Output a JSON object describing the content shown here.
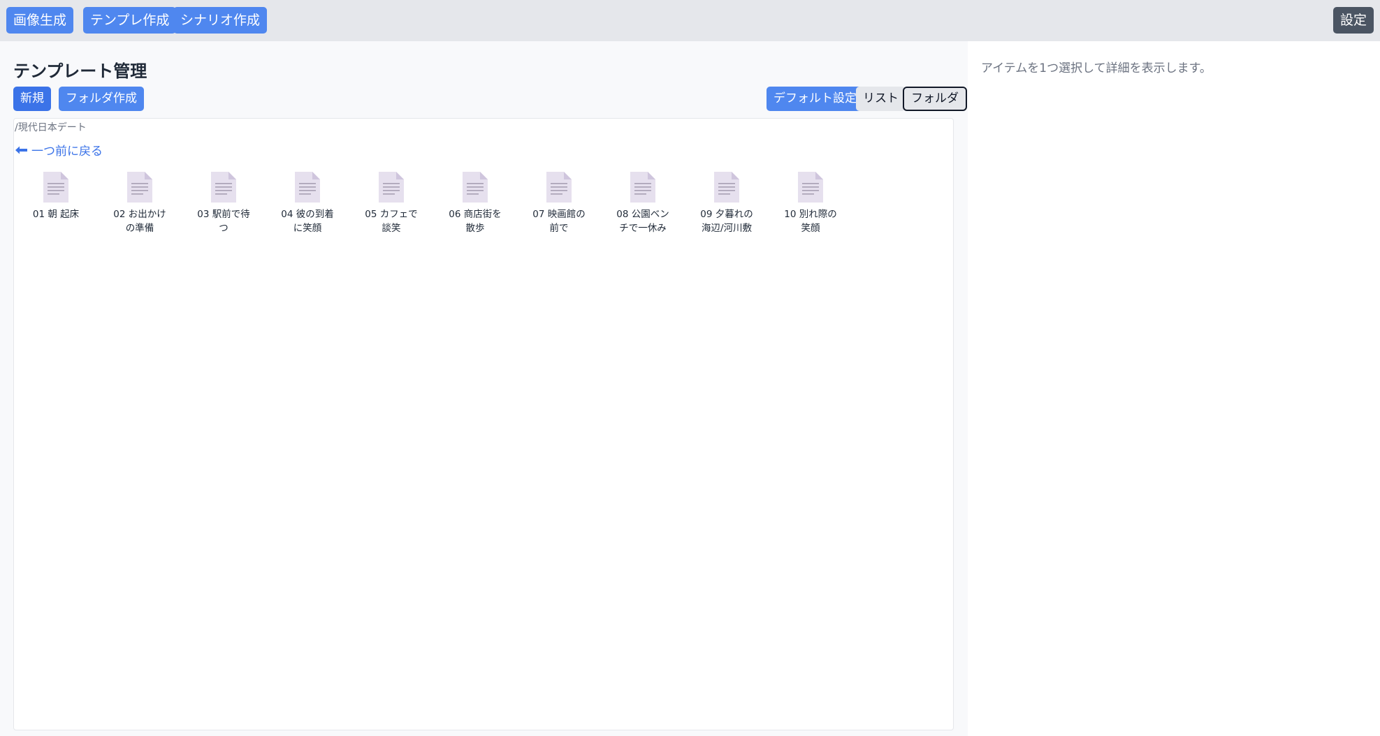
{
  "nav": {
    "image_gen": "画像生成",
    "template_create": "テンプレ作成",
    "scenario_create": "シナリオ作成",
    "settings": "設定"
  },
  "main": {
    "title": "テンプレート管理",
    "new_label": "新規",
    "new_folder_label": "フォルダ作成",
    "default_settings_label": "デフォルト設定",
    "list_view_label": "リスト",
    "folder_view_label": "フォルダ",
    "path": "/現代日本デート",
    "back_label": "一つ前に戻る",
    "files": [
      {
        "name": "01 朝 起床"
      },
      {
        "name": "02 お出かけの準備"
      },
      {
        "name": "03 駅前で待つ"
      },
      {
        "name": "04 彼の到着に笑顔"
      },
      {
        "name": "05 カフェで談笑"
      },
      {
        "name": "06 商店街を散歩"
      },
      {
        "name": "07 映画館の前で"
      },
      {
        "name": "08 公園ベンチで一休み"
      },
      {
        "name": "09 夕暮れの海辺/河川敷"
      },
      {
        "name": "10 別れ際の笑顔"
      }
    ]
  },
  "detail": {
    "hint": "アイテムを1つ選択して詳細を表示します。"
  },
  "colors": {
    "accent": "#4f87ef",
    "primary": "#3b73e8",
    "settings_button": "#4b5563",
    "topbar": "#e5e7eb",
    "file_icon": "#e6e0ee"
  },
  "icons": {
    "file": "document-icon",
    "back": "arrow-left-icon"
  }
}
